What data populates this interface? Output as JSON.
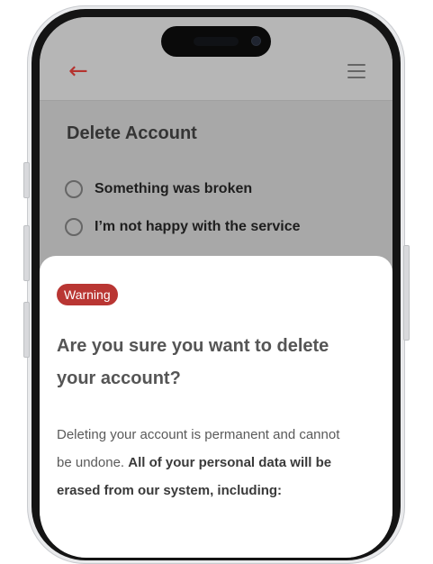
{
  "header": {
    "back_icon": "arrow-left-icon",
    "menu_icon": "hamburger-menu-icon",
    "accent_color": "#b5332f"
  },
  "page": {
    "title": "Delete Account",
    "options": [
      {
        "label": "Something was broken"
      },
      {
        "label": "I’m not happy with the service"
      }
    ]
  },
  "dialog": {
    "badge": "Warning",
    "badge_color": "#b93633",
    "title": "Are you sure you want to delete your account?",
    "body_text": "Deleting your account is permanent and cannot be undone.",
    "body_bold": "All of your personal data will be erased from our system, including:"
  }
}
